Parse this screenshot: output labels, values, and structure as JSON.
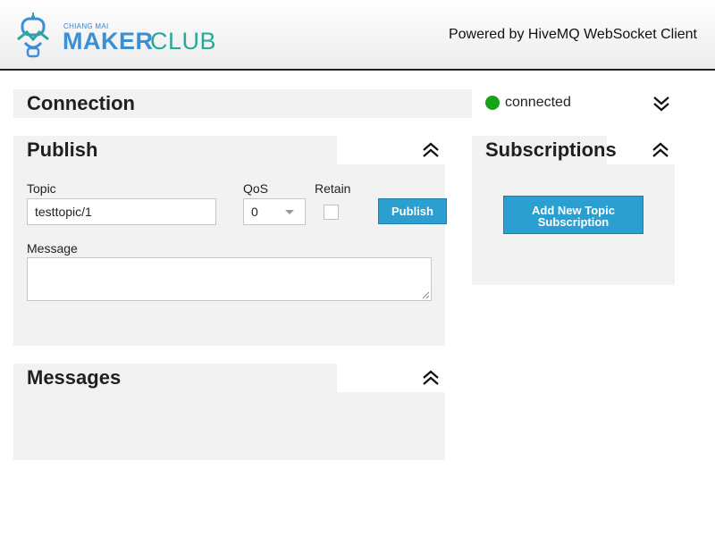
{
  "header": {
    "logo_small": "CHIANG MAI",
    "logo_maker": "MAKER",
    "logo_club": "CLUB",
    "powered_by": "Powered by HiveMQ WebSocket Client"
  },
  "connection": {
    "title": "Connection",
    "status_text": "connected",
    "status_color": "#17a317",
    "toggle_icon": "double-chevron-down-icon"
  },
  "publish": {
    "title": "Publish",
    "topic_label": "Topic",
    "topic_value": "testtopic/1",
    "qos_label": "QoS",
    "qos_value": "0",
    "retain_label": "Retain",
    "retain_checked": false,
    "publish_button": "Publish",
    "message_label": "Message",
    "message_value": "",
    "toggle_icon": "double-chevron-up-icon"
  },
  "subscriptions": {
    "title": "Subscriptions",
    "add_button_line1": "Add New Topic",
    "add_button_line2": "Subscription",
    "toggle_icon": "double-chevron-up-icon"
  },
  "messages": {
    "title": "Messages",
    "toggle_icon": "double-chevron-up-icon"
  },
  "colors": {
    "accent_button": "#2a9fd0",
    "panel_bg": "#f2f2f2",
    "logo_blue": "#3a8fd6",
    "logo_teal": "#2aa89a"
  }
}
